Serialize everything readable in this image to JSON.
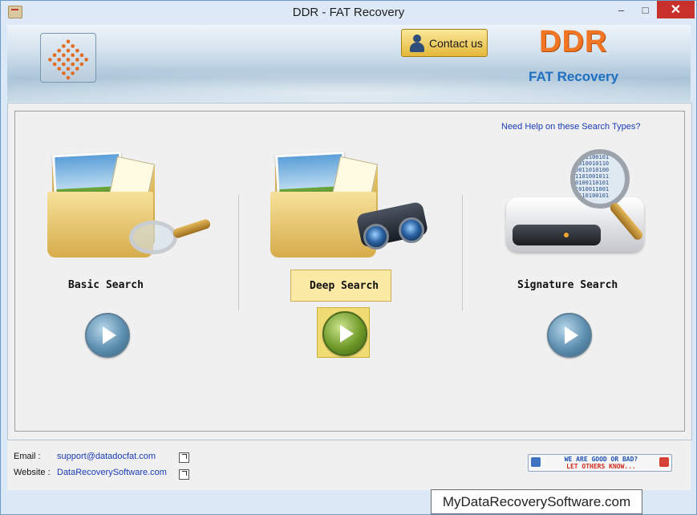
{
  "window": {
    "title": "DDR - FAT Recovery",
    "min_glyph": "–",
    "max_glyph": "□",
    "close_glyph": "✕"
  },
  "banner": {
    "contact_label": "Contact us",
    "brand": "DDR",
    "product": "FAT Recovery"
  },
  "main": {
    "help_link": "Need Help on these Search Types?",
    "searches": [
      {
        "label": "Basic Search",
        "selected": false,
        "icon": "folder-magnifier-icon"
      },
      {
        "label": "Deep Search",
        "selected": true,
        "icon": "folder-binoculars-icon"
      },
      {
        "label": "Signature Search",
        "selected": false,
        "icon": "drive-magnifier-icon"
      }
    ]
  },
  "footer": {
    "email_label": "Email :",
    "email_value": "support@datadocfat.com",
    "website_label": "Website :",
    "website_value": "DataRecoverySoftware.com",
    "rate_line1": "WE ARE GOOD OR BAD?",
    "rate_line2": "LET OTHERS KNOW..."
  },
  "watermark": "MyDataRecoverySoftware.com",
  "colors": {
    "accent_orange": "#f07524",
    "brand_blue": "#1f6fc1",
    "selection_yellow": "#fbe9a6"
  }
}
